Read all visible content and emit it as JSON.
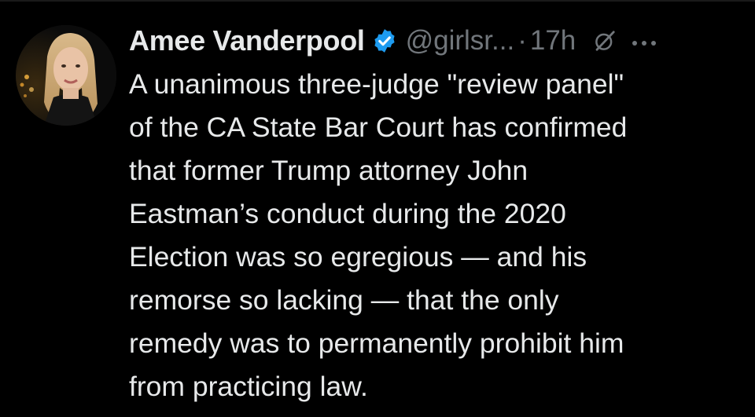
{
  "tweet": {
    "author": {
      "display_name": "Amee Vanderpool",
      "verified_icon": "verified-badge-icon",
      "handle": "@girlsr...",
      "avatar_icon": "avatar"
    },
    "separator": "·",
    "timestamp": "17h",
    "grok_icon": "grok-icon",
    "more_icon": "more-icon",
    "text_lines": [
      "A unanimous three-judge \"review panel\"",
      "of the CA State Bar Court has confirmed",
      "that former Trump attorney John",
      "Eastman’s conduct during the 2020",
      "Election was so egregious — and his",
      "remorse so lacking — that the only",
      "remedy was to permanently prohibit him",
      "from practicing law."
    ]
  },
  "colors": {
    "background": "#000000",
    "text_primary": "#e7e9ea",
    "text_secondary": "#71767b",
    "verified_blue": "#1d9bf0"
  }
}
